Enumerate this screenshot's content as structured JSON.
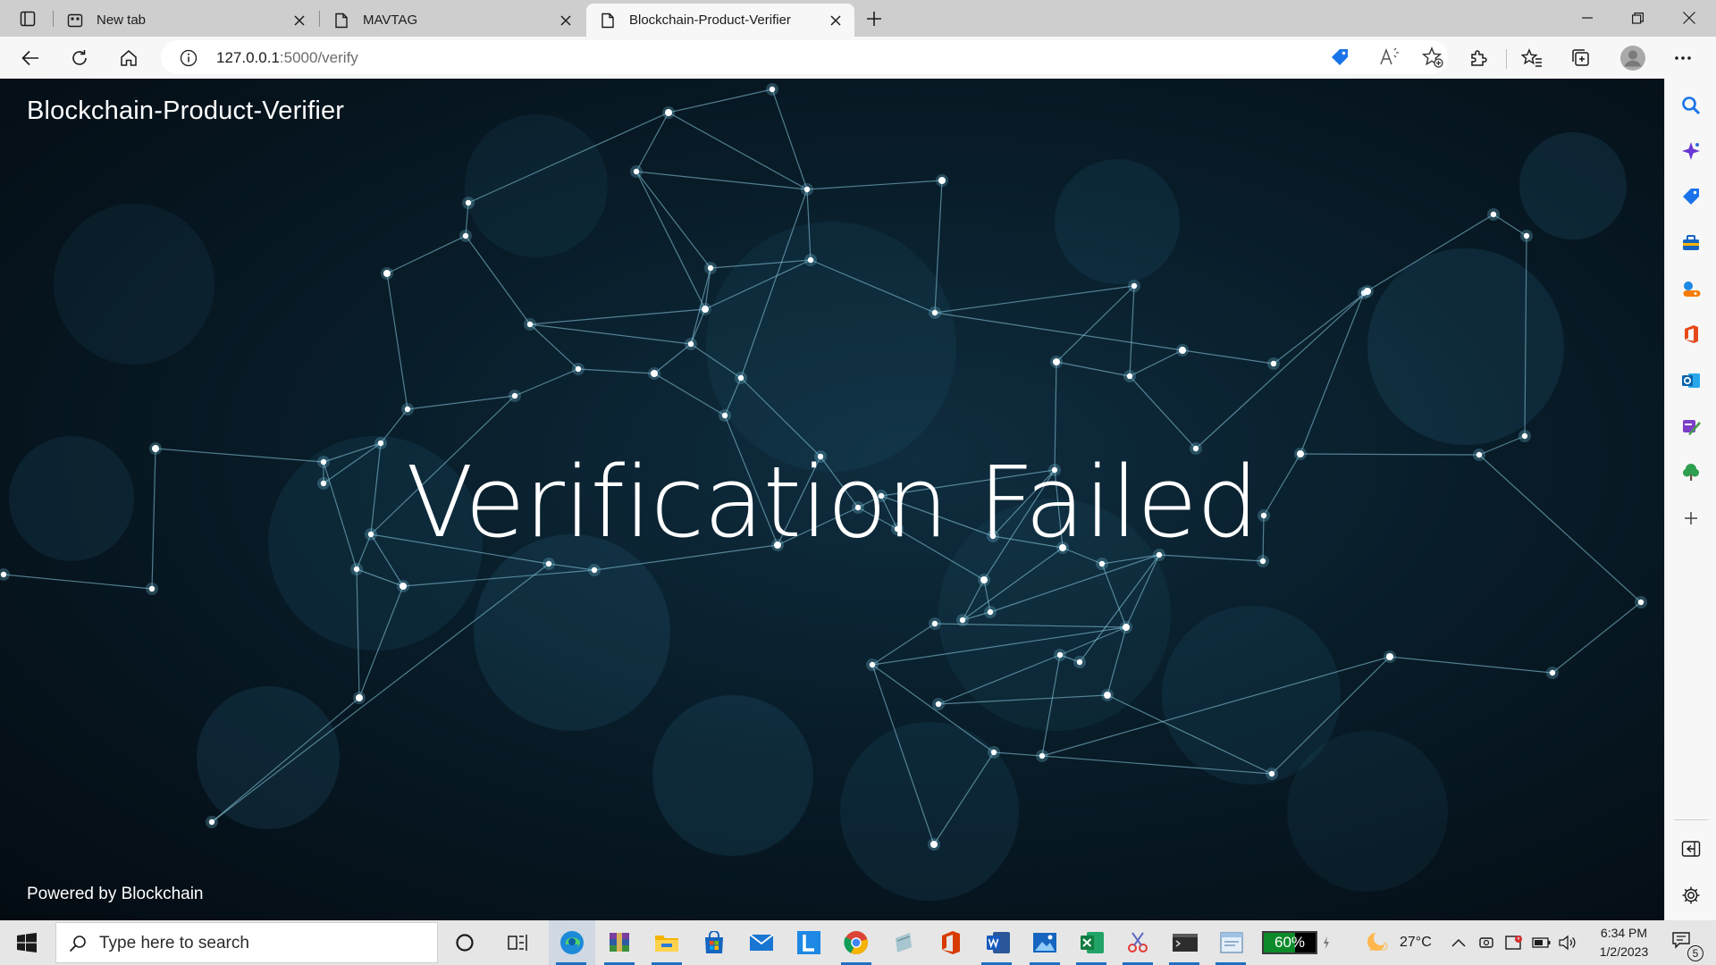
{
  "browser": {
    "tabs": [
      {
        "title": "New tab",
        "icon": "newtab-page-icon",
        "active": false
      },
      {
        "title": "MAVTAG",
        "icon": "document-icon",
        "active": false
      },
      {
        "title": "Blockchain-Product-Verifier",
        "icon": "document-icon",
        "active": true
      }
    ],
    "address": {
      "host": "127.0.0.1",
      "path": ":5000/verify"
    }
  },
  "page": {
    "brand": "Blockchain-Product-Verifier",
    "headline": "Verification Failed",
    "footer": "Powered by Blockchain"
  },
  "sidebar": {
    "items": [
      "search-icon",
      "copilot-icon",
      "shopping-icon",
      "tools-icon",
      "games-icon",
      "office-icon",
      "outlook-icon",
      "designer-icon",
      "tree-icon",
      "add-icon"
    ]
  },
  "taskbar": {
    "search_placeholder": "Type here to search",
    "battery_level": 0.6,
    "battery_label": "60%",
    "weather": "27°C",
    "time": "6:34 PM",
    "date": "1/2/2023",
    "notifications": "5"
  },
  "colors": {
    "tabstrip": "#cecece",
    "toolbar": "#f7f7f7",
    "page_bg": "#081c28",
    "network_node": "#ffffff",
    "network_line": "#8fd0e6",
    "taskbar": "#e6e6e6"
  }
}
